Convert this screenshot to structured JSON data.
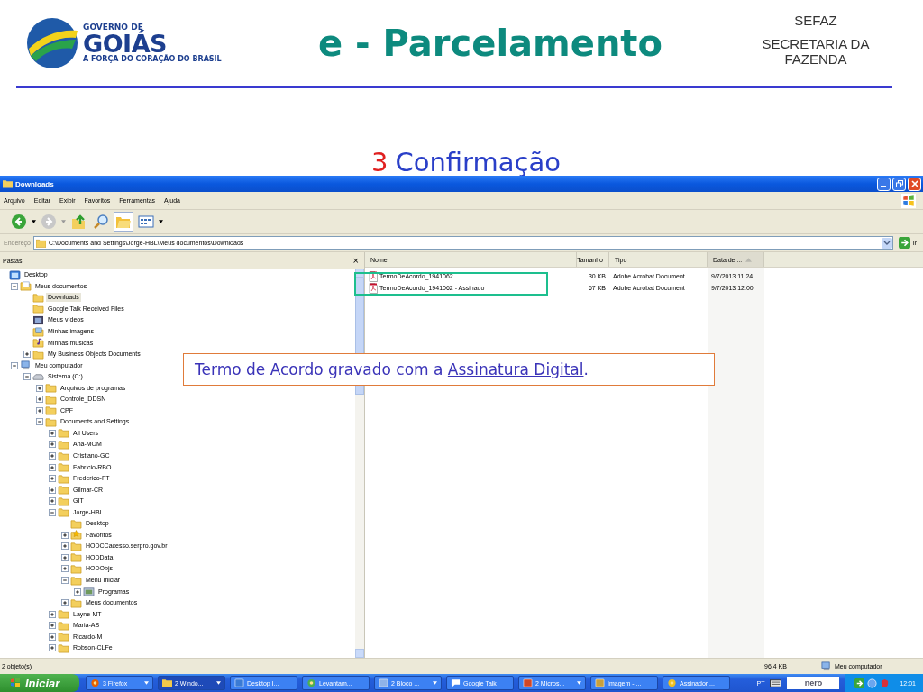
{
  "slide": {
    "title": "e - Parcelamento",
    "logo": {
      "line1": "GOVERNO DE",
      "line2": "GOIÁS",
      "tagline": "A FORÇA DO CORAÇÃO DO BRASIL"
    },
    "agency": {
      "acronym": "SEFAZ",
      "name_line1": "SECRETARIA DA",
      "name_line2": "FAZENDA"
    },
    "step": {
      "number": "3",
      "label": "Confirmação"
    }
  },
  "window": {
    "title": "Downloads",
    "menu": [
      "Arquivo",
      "Editar",
      "Exibir",
      "Favoritos",
      "Ferramentas",
      "Ajuda"
    ],
    "address": {
      "label": "Endereço",
      "value": "C:\\Documents and Settings\\Jorge-HBL\\Meus documentos\\Downloads",
      "go": "Ir"
    },
    "folders_pane": {
      "title": "Pastas",
      "close": "×",
      "tree": [
        {
          "label": "Desktop",
          "kind": "desktop",
          "expandable": false,
          "selected": false,
          "children": [
            {
              "label": "Meus documentos",
              "kind": "documents",
              "expandable": true,
              "expanded": true,
              "selected": false,
              "children": [
                {
                  "label": "Downloads",
                  "kind": "folder",
                  "expandable": false,
                  "selected": true
                },
                {
                  "label": "Google Talk Received Files",
                  "kind": "folder",
                  "expandable": false,
                  "selected": false
                },
                {
                  "label": "Meus vídeos",
                  "kind": "video",
                  "expandable": false,
                  "selected": false
                },
                {
                  "label": "Minhas imagens",
                  "kind": "pictures",
                  "expandable": false,
                  "selected": false
                },
                {
                  "label": "Minhas músicas",
                  "kind": "music",
                  "expandable": false,
                  "selected": false
                },
                {
                  "label": "My Business Objects Documents",
                  "kind": "folder",
                  "expandable": true,
                  "expanded": false,
                  "selected": false
                }
              ]
            },
            {
              "label": "Meu computador",
              "kind": "computer",
              "expandable": true,
              "expanded": true,
              "selected": false,
              "children": [
                {
                  "label": "Sistema (C:)",
                  "kind": "drive",
                  "expandable": true,
                  "expanded": true,
                  "selected": false,
                  "children": [
                    {
                      "label": "Arquivos de programas",
                      "kind": "folder",
                      "expandable": true,
                      "expanded": false,
                      "selected": false
                    },
                    {
                      "label": "Controle_DDSN",
                      "kind": "folder",
                      "expandable": true,
                      "expanded": false,
                      "selected": false
                    },
                    {
                      "label": "CPF",
                      "kind": "folder",
                      "expandable": true,
                      "expanded": false,
                      "selected": false
                    },
                    {
                      "label": "Documents and Settings",
                      "kind": "folder",
                      "expandable": true,
                      "expanded": true,
                      "selected": false,
                      "children": [
                        {
                          "label": "All Users",
                          "kind": "folder",
                          "expandable": true,
                          "expanded": false,
                          "selected": false
                        },
                        {
                          "label": "Ana-MOM",
                          "kind": "folder",
                          "expandable": true,
                          "expanded": false,
                          "selected": false
                        },
                        {
                          "label": "Cristiano-GC",
                          "kind": "folder",
                          "expandable": true,
                          "expanded": false,
                          "selected": false
                        },
                        {
                          "label": "Fabricio-RBO",
                          "kind": "folder",
                          "expandable": true,
                          "expanded": false,
                          "selected": false
                        },
                        {
                          "label": "Frederico-FT",
                          "kind": "folder",
                          "expandable": true,
                          "expanded": false,
                          "selected": false
                        },
                        {
                          "label": "Gilmar-CR",
                          "kind": "folder",
                          "expandable": true,
                          "expanded": false,
                          "selected": false
                        },
                        {
                          "label": "GIT",
                          "kind": "folder",
                          "expandable": true,
                          "expanded": false,
                          "selected": false
                        },
                        {
                          "label": "Jorge-HBL",
                          "kind": "folder",
                          "expandable": true,
                          "expanded": true,
                          "selected": false,
                          "children": [
                            {
                              "label": "Desktop",
                              "kind": "folder",
                              "expandable": false,
                              "selected": false
                            },
                            {
                              "label": "Favoritos",
                              "kind": "star",
                              "expandable": true,
                              "expanded": false,
                              "selected": false
                            },
                            {
                              "label": "HODCCacesso.serpro.gov.br",
                              "kind": "folder",
                              "expandable": true,
                              "expanded": false,
                              "selected": false
                            },
                            {
                              "label": "HODData",
                              "kind": "folder",
                              "expandable": true,
                              "expanded": false,
                              "selected": false
                            },
                            {
                              "label": "HODObjs",
                              "kind": "folder",
                              "expandable": true,
                              "expanded": false,
                              "selected": false
                            },
                            {
                              "label": "Menu Iniciar",
                              "kind": "folder",
                              "expandable": true,
                              "expanded": true,
                              "selected": false,
                              "children": [
                                {
                                  "label": "Programas",
                                  "kind": "programs",
                                  "expandable": true,
                                  "expanded": false,
                                  "selected": false
                                }
                              ]
                            },
                            {
                              "label": "Meus documentos",
                              "kind": "folder",
                              "expandable": true,
                              "expanded": false,
                              "selected": false
                            }
                          ]
                        },
                        {
                          "label": "Layne-MT",
                          "kind": "folder",
                          "expandable": true,
                          "expanded": false,
                          "selected": false
                        },
                        {
                          "label": "Maria-AS",
                          "kind": "folder",
                          "expandable": true,
                          "expanded": false,
                          "selected": false
                        },
                        {
                          "label": "Ricardo-M",
                          "kind": "folder",
                          "expandable": true,
                          "expanded": false,
                          "selected": false
                        },
                        {
                          "label": "Robson-CLFe",
                          "kind": "folder",
                          "expandable": true,
                          "expanded": false,
                          "selected": false
                        }
                      ]
                    }
                  ]
                }
              ]
            }
          ]
        }
      ]
    },
    "file_list": {
      "columns": [
        {
          "label": "Nome",
          "sorted": false
        },
        {
          "label": "Tamanho",
          "sorted": false
        },
        {
          "label": "Tipo",
          "sorted": false
        },
        {
          "label": "Data de ...",
          "sorted": true
        }
      ],
      "rows": [
        {
          "name": "TermoDeAcordo_1941062",
          "size": "30 KB",
          "type": "Adobe Acrobat Document",
          "date": "9/7/2013 11:24"
        },
        {
          "name": "TermoDeAcordo_1941062 - Assinado",
          "size": "67 KB",
          "type": "Adobe Acrobat Document",
          "date": "9/7/2013 12:00"
        }
      ]
    },
    "status_bar": {
      "count": "2 objeto(s)",
      "size": "96,4 KB",
      "zone": "Meu computador"
    }
  },
  "callout": {
    "before": "Termo de Acordo gravado com a ",
    "link": "Assinatura Digital",
    "after": "."
  },
  "taskbar": {
    "start": "Iniciar",
    "buttons": [
      {
        "label": "3 Firefox",
        "kind": "firefox",
        "group": true,
        "selected": false
      },
      {
        "label": "2 Windo...",
        "kind": "folder",
        "group": true,
        "selected": true
      },
      {
        "label": "Desktop I...",
        "kind": "desktop",
        "group": false,
        "selected": false
      },
      {
        "label": "Levantam...",
        "kind": "chrome",
        "group": false,
        "selected": false
      },
      {
        "label": "2 Bloco ...",
        "kind": "notepad",
        "group": true,
        "selected": false
      },
      {
        "label": "Google Talk",
        "kind": "chat",
        "group": false,
        "selected": false
      },
      {
        "label": "2 Micros...",
        "kind": "slides",
        "group": true,
        "selected": false
      },
      {
        "label": "Imagem - ...",
        "kind": "image",
        "group": false,
        "selected": false
      },
      {
        "label": "Assinador ...",
        "kind": "signer",
        "group": false,
        "selected": false
      }
    ],
    "language": "PT",
    "toolbar_logo": "nero",
    "clock": "12:01"
  }
}
